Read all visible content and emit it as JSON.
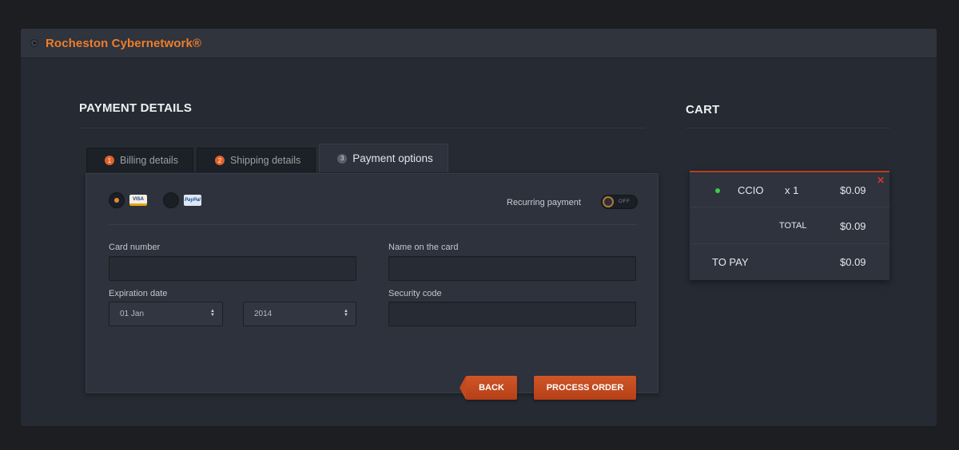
{
  "app": {
    "title": "Rocheston Cybernetwork®"
  },
  "payment": {
    "heading": "PAYMENT DETAILS",
    "tabs": [
      {
        "num": "1",
        "label": "Billing details"
      },
      {
        "num": "2",
        "label": "Shipping details"
      },
      {
        "num": "3",
        "label": "Payment options",
        "active": true
      }
    ],
    "methods": [
      {
        "name": "VISA",
        "selected": true
      },
      {
        "name": "PayPal",
        "selected": false
      }
    ],
    "recurring_label": "Recurring payment",
    "recurring_state": "OFF",
    "fields": {
      "card_number": {
        "label": "Card number",
        "value": ""
      },
      "name_on_card": {
        "label": "Name on the card",
        "value": ""
      },
      "expiration": {
        "label": "Expiration date",
        "month": "01 Jan",
        "year": "2014"
      },
      "security_code": {
        "label": "Security code",
        "value": ""
      }
    },
    "buttons": {
      "back": "BACK",
      "process": "PROCESS ORDER"
    }
  },
  "cart": {
    "heading": "CART",
    "items": [
      {
        "name": "CCIO",
        "qty": "x 1",
        "price": "$0.09"
      }
    ],
    "total_label": "TOTAL",
    "total_value": "$0.09",
    "to_pay_label": "TO PAY",
    "to_pay_value": "$0.09"
  },
  "colors": {
    "accent": "#ef7d2a",
    "button": "#c24a1f",
    "background": "#252a33"
  }
}
